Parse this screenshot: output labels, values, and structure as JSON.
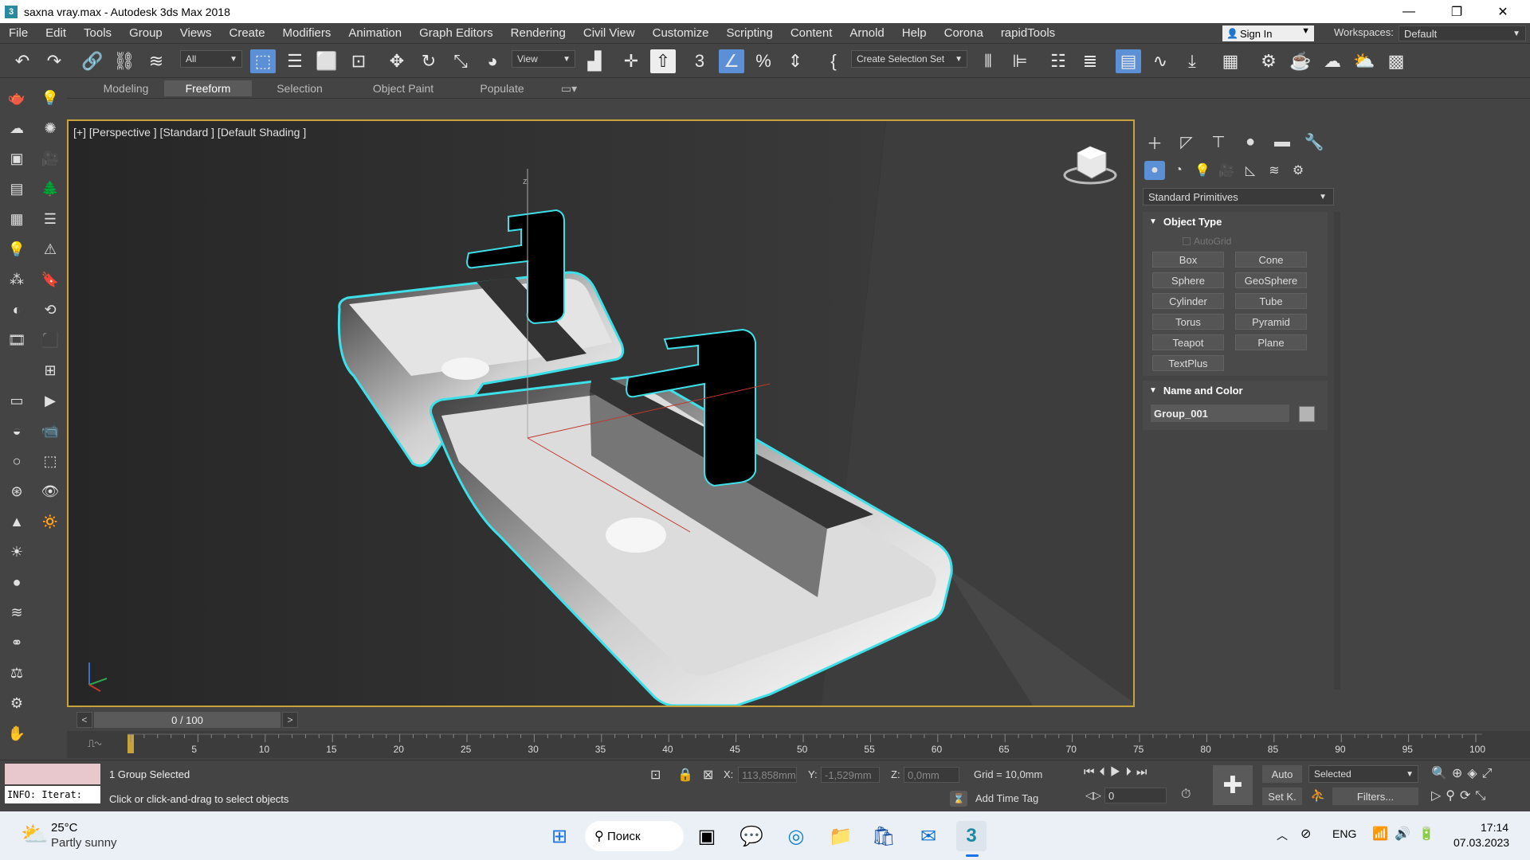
{
  "window": {
    "title": "saxna vray.max - Autodesk 3ds Max 2018",
    "minimize_glyph": "—",
    "restore_glyph": "❐",
    "close_glyph": "✕"
  },
  "menu": [
    "File",
    "Edit",
    "Tools",
    "Group",
    "Views",
    "Create",
    "Modifiers",
    "Animation",
    "Graph Editors",
    "Rendering",
    "Civil View",
    "Customize",
    "Scripting",
    "Content",
    "Arnold",
    "Help",
    "Corona",
    "rapidTools"
  ],
  "signin": {
    "label": "Sign In"
  },
  "workspaces": {
    "label": "Workspaces:",
    "value": "Default"
  },
  "toolbar": {
    "filter_value": "All",
    "refcoord_value": "View",
    "selection_set": "Create Selection Set"
  },
  "ribbon_tabs": [
    "Modeling",
    "Freeform",
    "Selection",
    "Object Paint",
    "Populate"
  ],
  "ribbon_active": "Freeform",
  "viewport": {
    "label": "[+] [Perspective ] [Standard ] [Default Shading ]",
    "axis_z": "z",
    "gizmo_axes": "x y z"
  },
  "command_panel": {
    "category": "Standard Primitives",
    "object_type_title": "Object Type",
    "autogrid": "AutoGrid",
    "primitives": [
      "Box",
      "Cone",
      "Sphere",
      "GeoSphere",
      "Cylinder",
      "Tube",
      "Torus",
      "Pyramid",
      "Teapot",
      "Plane",
      "TextPlus"
    ],
    "name_color_title": "Name and Color",
    "object_name": "Group_001",
    "object_color": "#b4b4b4"
  },
  "timeline": {
    "frame_label": "0 / 100",
    "prev": "<",
    "next": ">",
    "ticks": [
      "5",
      "10",
      "15",
      "20",
      "25",
      "30",
      "35",
      "40",
      "45",
      "50",
      "55",
      "60",
      "65",
      "70",
      "75",
      "80",
      "85",
      "90",
      "95",
      "100"
    ]
  },
  "status": {
    "info_text": "INFO: Iterat:",
    "selected_text": "1 Group Selected",
    "prompt_text": "Click or click-and-drag to select objects",
    "x_label": "X:",
    "x_value": "113,858mm",
    "y_label": "Y:",
    "y_value": "-1,529mm",
    "z_label": "Z:",
    "z_value": "0,0mm",
    "grid": "Grid = 10,0mm",
    "add_time_tag": "Add Time Tag",
    "auto": "Auto",
    "setk": "Set K.",
    "selected_dropdown": "Selected",
    "filters": "Filters...",
    "frame_spinner": "0"
  },
  "taskbar": {
    "temperature": "25°C",
    "weather": "Partly sunny",
    "search": "Поиск",
    "lang": "ENG",
    "time": "17:14",
    "date": "07.03.2023"
  },
  "colors": {
    "accent_blue": "#5b8fd6",
    "viewport_border": "#c8a23a",
    "selection_outline": "#3de0e8"
  }
}
